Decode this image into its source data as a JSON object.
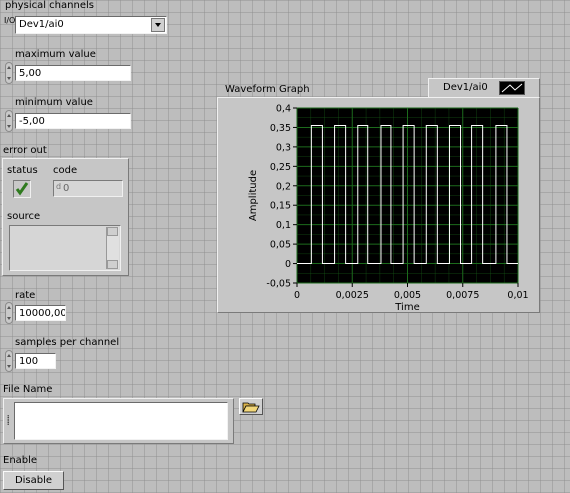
{
  "physical_channels": {
    "label": "physical channels",
    "value": "Dev1/ai0",
    "io_icon": "I/O"
  },
  "maximum_value": {
    "label": "maximum value",
    "value": "5,00"
  },
  "minimum_value": {
    "label": "minimum value",
    "value": "-5,00"
  },
  "error_out": {
    "label": "error out",
    "status_label": "status",
    "code_label": "code",
    "code_value": "0",
    "source_label": "source",
    "source_value": ""
  },
  "rate": {
    "label": "rate",
    "value": "10000,00"
  },
  "samples_per_channel": {
    "label": "samples per channel",
    "value": "100"
  },
  "file_name": {
    "label": "File Name",
    "value": ""
  },
  "enable": {
    "label": "Enable",
    "button_label": "Disable"
  },
  "graph": {
    "title": "Waveform Graph",
    "legend_label": "Dev1/ai0",
    "plot_bg": "#000000",
    "grid_color": "#1c6b1c",
    "trace_color": "#ffffff"
  },
  "chart_data": {
    "type": "line",
    "title": "Waveform Graph",
    "xlabel": "Time",
    "ylabel": "Amplitude",
    "xlim": [
      0,
      0.01
    ],
    "ylim": [
      -0.05,
      0.4
    ],
    "x_ticks": [
      "0",
      "0,0025",
      "0,005",
      "0,0075",
      "0,01"
    ],
    "y_ticks": [
      "0,4",
      "0,35",
      "0,3",
      "0,25",
      "0,2",
      "0,15",
      "0,1",
      "0,05",
      "0",
      "-0,05"
    ],
    "grid": true,
    "legend": "top-right",
    "series": [
      {
        "name": "Dev1/ai0",
        "square_wave": {
          "low": 0.0,
          "high": 0.355,
          "rising_edges": [
            0.00065,
            0.0017,
            0.00275,
            0.0038,
            0.0048,
            0.00585,
            0.0069,
            0.0079,
            0.009
          ],
          "falling_edges": [
            0.00115,
            0.0022,
            0.0032,
            0.00425,
            0.0053,
            0.00635,
            0.0074,
            0.0084,
            0.0095
          ]
        }
      }
    ]
  }
}
